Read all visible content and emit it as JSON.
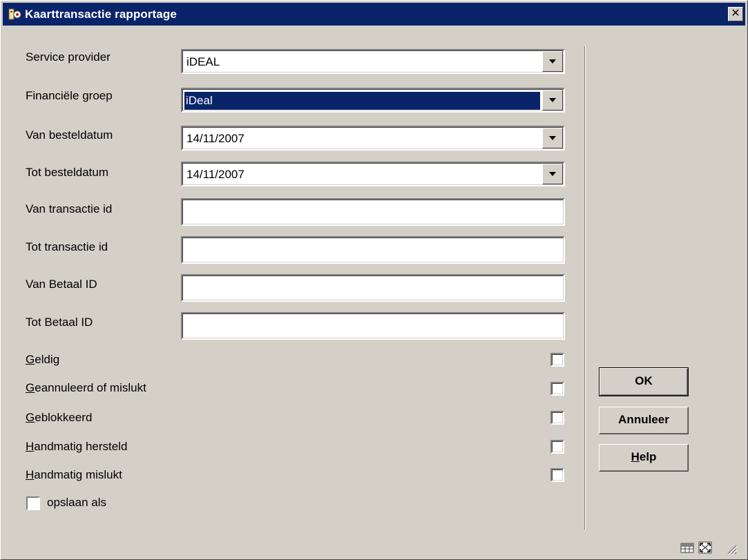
{
  "window": {
    "title": "Kaarttransactie rapportage"
  },
  "form": {
    "service_provider": {
      "label": "Service provider",
      "value": "iDEAL"
    },
    "financiele_groep": {
      "label": "Financiële groep",
      "value": "iDeal"
    },
    "van_besteldatum": {
      "label": "Van besteldatum",
      "value": "14/11/2007"
    },
    "tot_besteldatum": {
      "label": "Tot besteldatum",
      "value": "14/11/2007"
    },
    "van_transactie_id": {
      "label": "Van transactie id",
      "value": ""
    },
    "tot_transactie_id": {
      "label": "Tot transactie id",
      "value": ""
    },
    "van_betaal_id": {
      "label": "Van Betaal ID",
      "value": ""
    },
    "tot_betaal_id": {
      "label": "Tot Betaal ID",
      "value": ""
    }
  },
  "checkboxes": [
    {
      "mnemonic": "G",
      "rest": "eldig",
      "checked": false
    },
    {
      "mnemonic": "G",
      "rest": "eannuleerd of mislukt",
      "checked": false
    },
    {
      "mnemonic": "G",
      "rest": "eblokkeerd",
      "checked": false
    },
    {
      "mnemonic": "H",
      "rest": "andmatig hersteld",
      "checked": false
    },
    {
      "mnemonic": "H",
      "rest": "andmatig mislukt",
      "checked": false
    }
  ],
  "opslaan": {
    "label": "opslaan als",
    "checked": false
  },
  "buttons": {
    "ok": "OK",
    "annuleer": "Annuleer",
    "help_mnemonic": "H",
    "help_rest": "elp"
  },
  "icons": {
    "app": "app-key-icon",
    "close": "close-icon",
    "grid": "grid-icon",
    "maximize": "maximize-icon",
    "resize": "resize-grip-icon"
  },
  "colors": {
    "titlebar": "#0a246a",
    "window": "#d4d0c8",
    "selection": "#0a246a"
  }
}
